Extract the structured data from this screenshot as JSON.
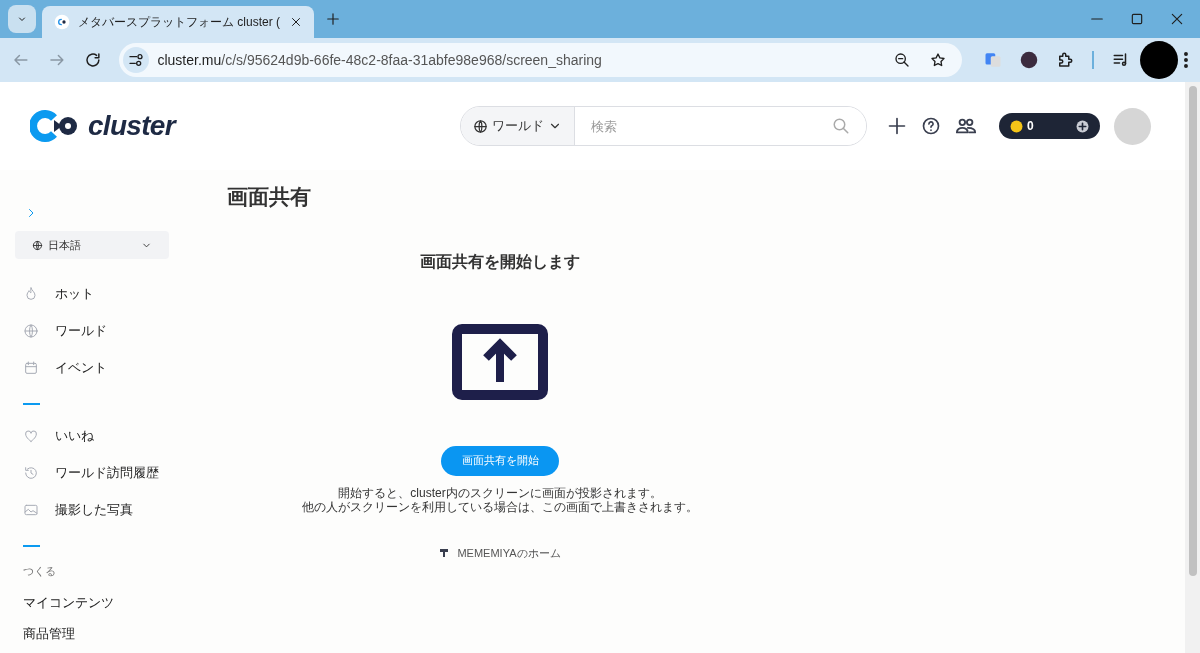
{
  "browser": {
    "tab": {
      "title": "メタバースプラットフォーム cluster (",
      "selected": true
    },
    "url": {
      "host": "cluster.mu",
      "path": "/c/s/95624d9b-66fe-48c2-8faa-31abfe98e968/screen_sharing"
    }
  },
  "header": {
    "logo": "cluster",
    "search": {
      "scope": "ワールド",
      "placeholder": "検索"
    },
    "coins": "0"
  },
  "sidebar": {
    "language": "日本語",
    "sections": [
      {
        "items": [
          {
            "label": "ホット"
          },
          {
            "label": "ワールド"
          },
          {
            "label": "イベント"
          }
        ]
      },
      {
        "items": [
          {
            "label": "いいね"
          },
          {
            "label": "ワールド訪問履歴"
          },
          {
            "label": "撮影した写真"
          }
        ]
      },
      {
        "heading": "つくる",
        "items": [
          {
            "label": "マイコンテンツ"
          },
          {
            "label": "商品管理"
          }
        ]
      }
    ]
  },
  "main": {
    "title": "画面共有",
    "heading": "画面共有を開始します",
    "button": "画面共有を開始",
    "notes": [
      "開始すると、cluster内のスクリーンに画面が投影されます。",
      "他の人がスクリーンを利用している場合は、この画面で上書きされます。"
    ],
    "home_link": "MEMEMIYAのホーム"
  }
}
